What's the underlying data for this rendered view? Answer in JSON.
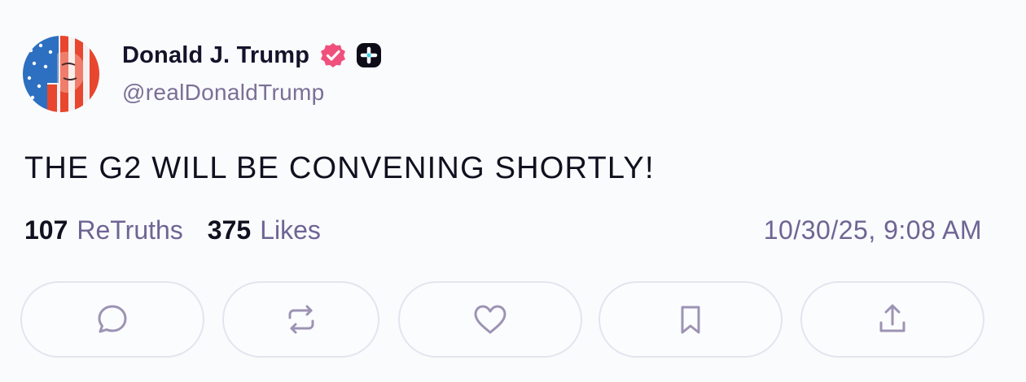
{
  "author": {
    "display_name": "Donald J. Trump",
    "handle": "@realDonaldTrump",
    "avatar": "flag-face-avatar",
    "verified_icon": "verified-badge-icon",
    "plus_icon": "plus-badge-icon"
  },
  "post": {
    "text": "THE G2 WILL BE CONVENING SHORTLY!"
  },
  "stats": {
    "retruths_count": "107",
    "retruths_label": "ReTruths",
    "likes_count": "375",
    "likes_label": "Likes",
    "timestamp": "10/30/25, 9:08 AM"
  },
  "actions": [
    {
      "name": "reply",
      "icon": "speech-bubble-icon"
    },
    {
      "name": "retruth",
      "icon": "repost-arrows-icon"
    },
    {
      "name": "like",
      "icon": "heart-icon"
    },
    {
      "name": "bookmark",
      "icon": "bookmark-icon"
    },
    {
      "name": "share",
      "icon": "share-upload-icon"
    }
  ],
  "colors": {
    "background": "#f9fbfd",
    "text": "#11101f",
    "muted": "#6f6494",
    "verified": "#f0517c",
    "button_border": "#e6e3ee",
    "icon": "#9d93b4"
  }
}
